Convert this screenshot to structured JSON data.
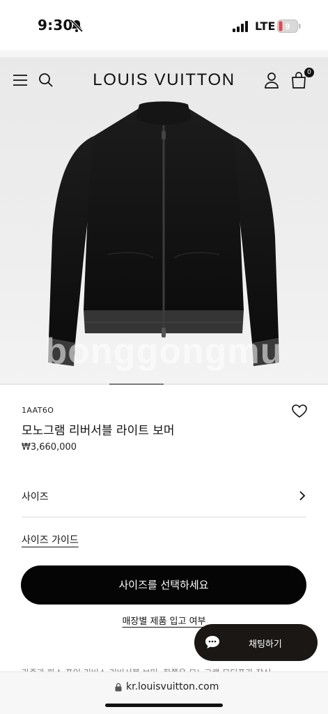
{
  "status_bar": {
    "time": "9:30",
    "network": "LTE",
    "battery_level": "9",
    "icons": [
      "bell-off-icon",
      "signal-icon",
      "battery-icon"
    ]
  },
  "header": {
    "brand": "LOUIS VUITTON",
    "bag_count": "0",
    "icons": [
      "menu-icon",
      "search-icon",
      "account-icon",
      "bag-icon"
    ]
  },
  "hero": {
    "watermark": "bonggongmu",
    "carousel_index": 2
  },
  "product": {
    "sku": "1AAT6O",
    "name": "모노그램 리버서블 라이트 보머",
    "price": "₩3,660,000",
    "wishlist_icon": "heart-icon"
  },
  "size": {
    "label": "사이즈",
    "guide_label": "사이즈 가이드"
  },
  "actions": {
    "select_size": "사이즈를 선택하세요",
    "store_stock": "매장별 제품 입고 여부",
    "chat": "채팅하기"
  },
  "description_peek": "가죽과 파스 포인 리버스 리버서블 보머, 한쪽은 모노그램 모티프가 장식",
  "browser": {
    "url": "kr.louisvuitton.com"
  },
  "colors": {
    "button_bg": "#050505",
    "chat_bg": "#1a1714",
    "battery_low": "#e5484d"
  }
}
